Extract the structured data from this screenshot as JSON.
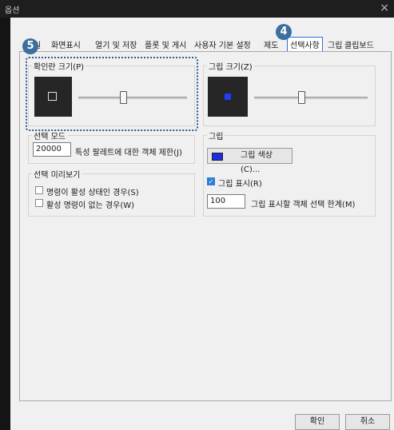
{
  "window": {
    "title": "옵션",
    "close_icon": "×"
  },
  "tabs": [
    {
      "label": "일"
    },
    {
      "label": "화면표시"
    },
    {
      "label": "열기 및 저장"
    },
    {
      "label": "플롯 및 게시"
    },
    {
      "label": "사용자 기본 설정"
    },
    {
      "label": "제도"
    },
    {
      "label": "선택사항",
      "active": true
    },
    {
      "label": "그립"
    },
    {
      "label": "클립보드"
    }
  ],
  "badges": {
    "step4": "4",
    "step5": "5",
    "color": "#3d6e9e",
    "highlight_color": "#2e5c8a"
  },
  "pickbox": {
    "title": "확인란 크기(P)",
    "slider_value": 0.4
  },
  "grip_size": {
    "title": "그립 크기(Z)",
    "slider_value": 0.4,
    "swatch_color": "#1f3fff"
  },
  "selection_mode": {
    "title": "선택 모드",
    "limit_value": "20000",
    "limit_label": "특성 팔레트에 대한 객체 제한(J)"
  },
  "selection_preview": {
    "title": "선택 미리보기",
    "options": [
      {
        "label": "명령이 활성 상태인 경우(S)",
        "checked": false
      },
      {
        "label": "활성 명령이 없는 경우(W)",
        "checked": false
      }
    ]
  },
  "grip": {
    "title": "그립",
    "color_button": "그립 색상(C)...",
    "color_swatch": "#1b2fe0",
    "show_label": "그립 표시(R)",
    "show_checked": true,
    "limit_value": "100",
    "limit_label": "그립 표시할 객체 선택 한계(M)"
  },
  "footer": {
    "ok": "확인",
    "cancel": "취소"
  }
}
